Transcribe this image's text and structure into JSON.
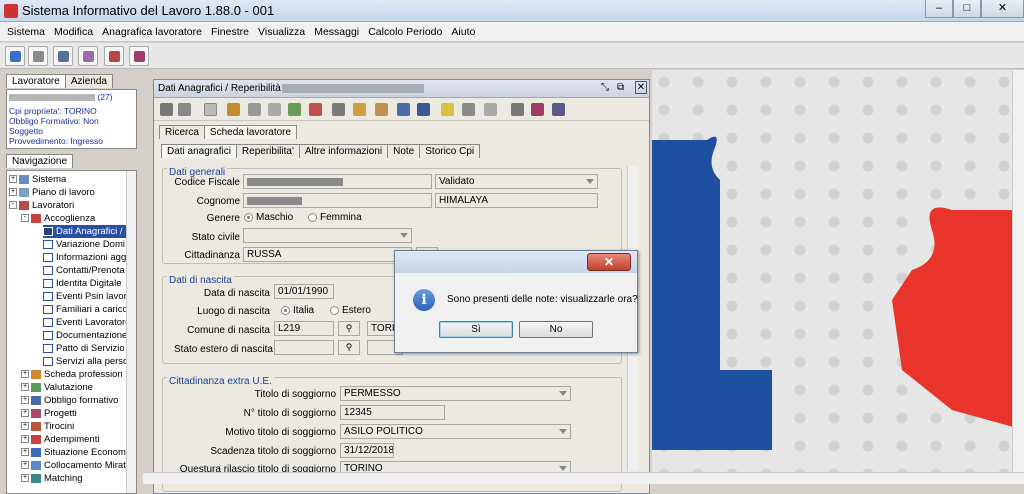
{
  "window": {
    "title": "Sistema Informativo del Lavoro 1.88.0 - 001"
  },
  "menu": [
    "Sistema",
    "Modifica",
    "Anagrafica lavoratore",
    "Finestre",
    "Visualizza",
    "Messaggi",
    "Calcolo Periodo",
    "Aiuto"
  ],
  "left": {
    "tabs": [
      "Lavoratore",
      "Azienda"
    ],
    "info": {
      "count": "(27)",
      "line1": "Cpi proprieta': TORINO",
      "line2": "Obbligo Formativo: Non",
      "line3": "Soggetto",
      "line4": "Provvedimento: Ingresso"
    },
    "nav_tab": "Navigazione",
    "tree": [
      "Sistema",
      "Piano di lavoro",
      "Lavoratori",
      "Accoglienza",
      "Dati Anagrafici / I",
      "Variazione Domi",
      "Informazioni agg",
      "Contatti/Prenota",
      "Identita Digitale",
      "Eventi Psin lavor",
      "Familiari a carico",
      "Eventi Lavoratore",
      "Documentazione",
      "Patto di Servizio",
      "Servizi alla perso",
      "Scheda profession",
      "Valutazione",
      "Obbligo formativo",
      "Progetti",
      "Tirocini",
      "Adempimenti",
      "Situazione Econom",
      "Collocamento Mirat",
      "Matching"
    ]
  },
  "frame": {
    "title": "Dati Anagrafici / Reperibilità -",
    "outer_tabs": [
      "Ricerca",
      "Scheda lavoratore"
    ],
    "inner_tabs": [
      "Dati anagrafici",
      "Reperibilita'",
      "Altre informazioni",
      "Note",
      "Storico Cpi"
    ],
    "generali": {
      "title": "Dati generali",
      "codice_fiscale_label": "Codice Fiscale",
      "validato": "Validato",
      "cognome_label": "Cognome",
      "nome_value": "HIMALAYA",
      "genere_label": "Genere",
      "maschio": "Maschio",
      "femmina": "Femmina",
      "stato_civile_label": "Stato civile",
      "cittadinanza_label": "Cittadinanza",
      "cittadinanza_value": "RUSSA"
    },
    "nascita": {
      "title": "Dati di nascita",
      "data_label": "Data di nascita",
      "data_value": "01/01/1990",
      "luogo_label": "Luogo di nascita",
      "italia": "Italia",
      "estero": "Estero",
      "comune_label": "Comune di nascita",
      "comune_code": "L219",
      "comune_name": "TORI",
      "stato_estero_label": "Stato estero di nascita"
    },
    "extra_ue": {
      "title": "Cittadinanza extra U.E.",
      "titolo_label": "Titolo di soggiorno",
      "titolo_value": "PERMESSO",
      "numero_label": "N° titolo di soggiorno",
      "numero_value": "12345",
      "motivo_label": "Motivo titolo di soggiorno",
      "motivo_value": "ASILO POLITICO",
      "scadenza_label": "Scadenza titolo di soggiorno",
      "scadenza_value": "31/12/2018",
      "questura_label": "Questura rilascio titolo di soggiorno",
      "questura_value": "TORINO"
    }
  },
  "dialog": {
    "message": "Sono presenti delle note: visualizzarle ora?",
    "yes": "Sì",
    "no": "No"
  }
}
